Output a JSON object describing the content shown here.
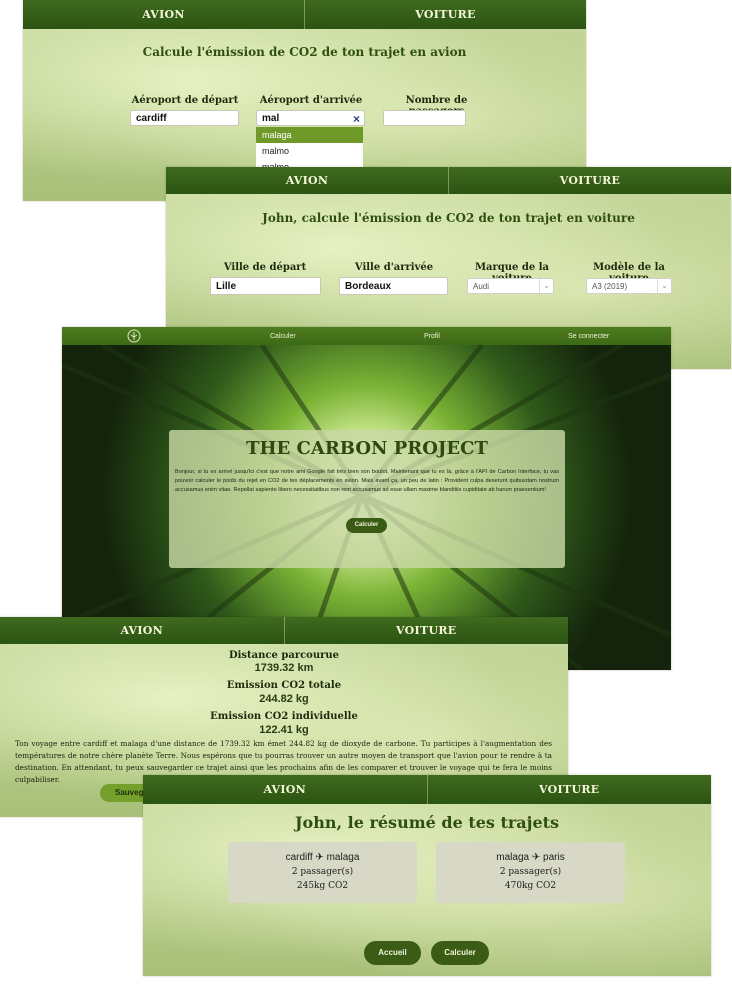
{
  "panel_avion_form": {
    "tabs": [
      "AVION",
      "VOITURE"
    ],
    "heading": "Calcule l'émission de CO2 de ton trajet en avion",
    "labels": {
      "departure": "Aéroport de départ",
      "arrival": "Aéroport d'arrivée",
      "passengers": "Nombre de passagers"
    },
    "values": {
      "departure": "cardiff",
      "arrival": "mal",
      "passengers": ""
    },
    "clear_icon": "×",
    "dropdown": [
      "malaga",
      "malmo",
      "malmo"
    ]
  },
  "panel_voiture_form": {
    "tabs": [
      "AVION",
      "VOITURE"
    ],
    "heading": "John, calcule l'émission de CO2 de ton trajet en voiture",
    "labels": {
      "departure": "Ville de départ",
      "arrival": "Ville d'arrivée",
      "brand": "Marque de la voiture",
      "model": "Modèle de la voiture"
    },
    "values": {
      "departure": "Lille",
      "arrival": "Bordeaux",
      "brand": "Audi",
      "model": "A3 (2019)"
    }
  },
  "panel_home": {
    "nav": {
      "calculer": "Calculer",
      "profil": "Profil",
      "connect": "Se connecter"
    },
    "title": "THE CARBON PROJECT",
    "intro": "Bonjour, si tu es arrivé jusqu'ici c'est que notre ami Google fait très bien son boulot. Maintenant que tu es là, grâce à l'API de Carbon Interface, tu vas pouvoir calculer le poids du rejet en CO2 de tes déplacements en avion. Mais avant ça, un peu de latin : Provident culpa deserunt quibusdam nostrum accusamus enim vitae. Repellat sapiente libero necessitatibus non rem accusamus ad esse ullam maxime blanditiis cupiditate ab harum praesentium!",
    "button": "Calculer"
  },
  "panel_result": {
    "tabs": [
      "AVION",
      "VOITURE"
    ],
    "distance_label": "Distance parcourue",
    "distance_value": "1739.32 km",
    "total_label": "Emission CO2 totale",
    "total_value": "244.82 kg",
    "individual_label": "Emission CO2 individuelle",
    "individual_value": "122.41 kg",
    "message": "Ton voyage entre cardiff et malaga d'une distance de 1739.32 km émet 244.82 kg de dioxyde de carbone. Tu participes à l'augmentation des températures de notre chère planète Terre. Nous espérons que tu pourras trouver un autre moyen de transport que l'avion pour te rendre à ta destination. En attendant, tu peux sauvegarder ce trajet ainsi que les prochains afin de les comparer et trouver le voyage qui te fera le moins culpabiliser.",
    "save_button": "Sauvega"
  },
  "panel_summary": {
    "tabs": [
      "AVION",
      "VOITURE"
    ],
    "heading": "John, le résumé de tes trajets",
    "trips": [
      {
        "from": "cardiff",
        "to": "malaga",
        "passengers": "2 passager(s)",
        "co2": "245kg CO2"
      },
      {
        "from": "malaga",
        "to": "paris",
        "passengers": "2 passager(s)",
        "co2": "470kg CO2"
      }
    ],
    "plane_icon": "✈",
    "buttons": {
      "home": "Accueil",
      "calc": "Calculer"
    }
  }
}
